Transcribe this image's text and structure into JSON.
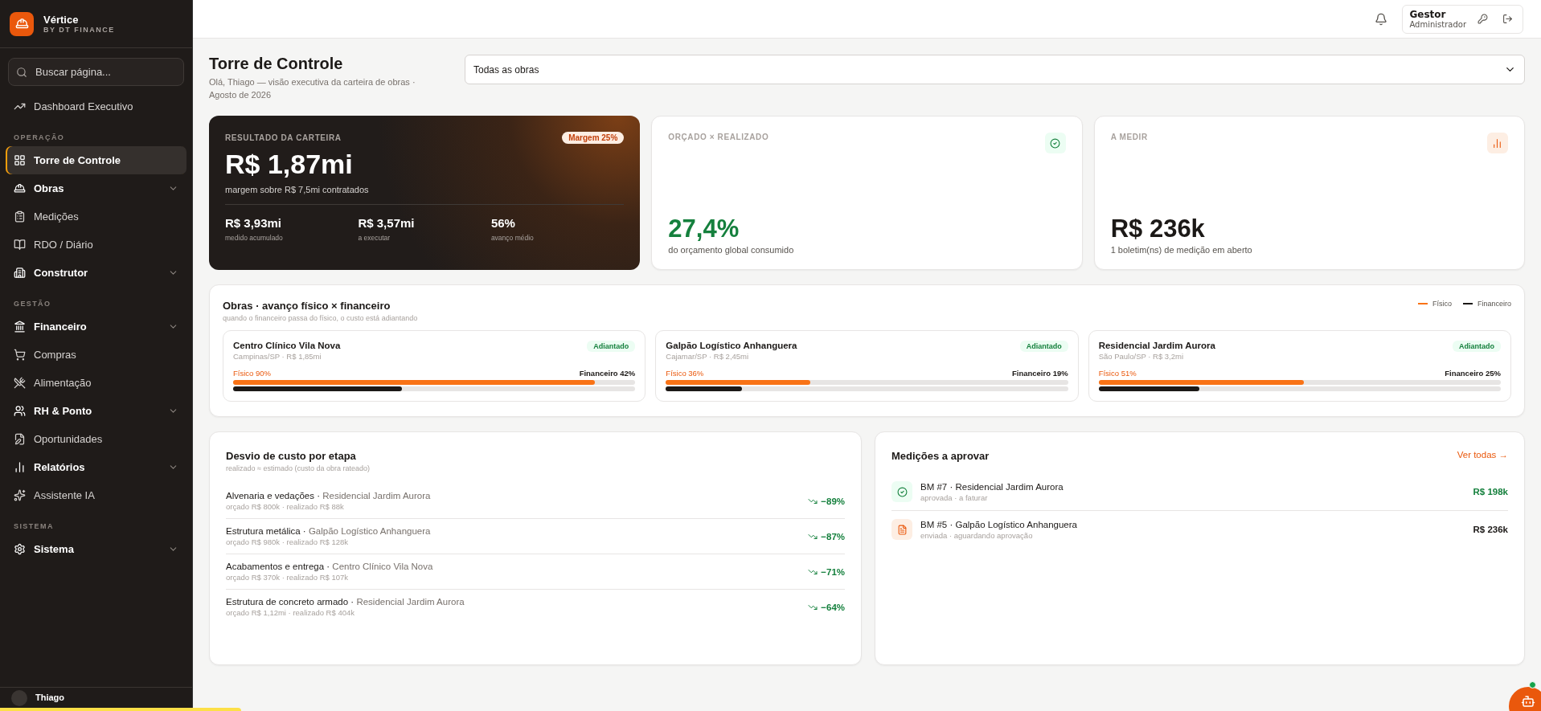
{
  "brand": {
    "name": "Vértice",
    "tagline": "BY DT FINANCE"
  },
  "search": {
    "placeholder": "Buscar página..."
  },
  "sidebar": {
    "top_items": [
      {
        "label": "Dashboard Executivo",
        "kind": "link",
        "selected": false
      }
    ],
    "sections": [
      {
        "heading": "OPERAÇÃO",
        "items": [
          {
            "label": "Torre de Controle",
            "kind": "link",
            "selected": true
          },
          {
            "label": "Obras",
            "kind": "group",
            "selected": false,
            "expanded": false
          },
          {
            "label": "Medições",
            "kind": "link",
            "selected": false
          },
          {
            "label": "RDO / Diário",
            "kind": "link",
            "selected": false
          },
          {
            "label": "Construtor",
            "kind": "group",
            "selected": false,
            "expanded": false
          }
        ]
      },
      {
        "heading": "GESTÃO",
        "items": [
          {
            "label": "Financeiro",
            "kind": "group",
            "selected": false,
            "expanded": false
          },
          {
            "label": "Compras",
            "kind": "link",
            "selected": false
          },
          {
            "label": "Alimentação",
            "kind": "link",
            "selected": false
          },
          {
            "label": "RH & Ponto",
            "kind": "group",
            "selected": false,
            "expanded": false
          },
          {
            "label": "Oportunidades",
            "kind": "link",
            "selected": false
          },
          {
            "label": "Relatórios",
            "kind": "group",
            "selected": false,
            "expanded": false
          },
          {
            "label": "Assistente IA",
            "kind": "link",
            "selected": false
          }
        ]
      },
      {
        "heading": "SISTEMA",
        "items": [
          {
            "label": "Sistema",
            "kind": "group",
            "selected": false,
            "expanded": false
          }
        ]
      }
    ]
  },
  "sidebar_user": {
    "name": "Thiago"
  },
  "header": {
    "user_name": "Gestor",
    "user_role": "Administrador"
  },
  "page": {
    "title": "Torre de Controle",
    "subtitle": "Olá, Thiago — visão executiva da carteira de obras · Agosto de 2026"
  },
  "filter": {
    "value": "Todas as obras"
  },
  "portfolio": {
    "label": "RESULTADO DA CARTEIRA",
    "badge": "Margem 25%",
    "value": "R$ 1,87mi",
    "caption": "margem sobre R$ 7,5mi contratados",
    "stats": [
      {
        "value": "R$ 3,93mi",
        "label": "medido acumulado"
      },
      {
        "value": "R$ 3,57mi",
        "label": "a executar"
      },
      {
        "value": "56%",
        "label": "avanço médio"
      }
    ]
  },
  "kpis": [
    {
      "kind": "check",
      "label": "ORÇADO × REALIZADO",
      "value": "27,4%",
      "caption": "do orçamento global consumido"
    },
    {
      "kind": "chart",
      "label": "A MEDIR",
      "value": "R$ 236k",
      "caption": "1 boletim(ns) de medição em aberto"
    }
  ],
  "progress": {
    "title": "Obras · avanço físico × financeiro",
    "subtitle": "quando o financeiro passa do físico, o custo está adiantando",
    "legend": [
      {
        "label": "Físico",
        "color": "#f97316"
      },
      {
        "label": "Financeiro",
        "color": "#1c1917"
      }
    ],
    "projects": [
      {
        "name": "Centro Clínico Vila Nova",
        "meta": "Campinas/SP · R$ 1,85mi",
        "status": "Adiantado",
        "physical": {
          "label": "Físico 90%",
          "level": 0.9
        },
        "financial": {
          "label": "Financeiro 42%",
          "level": 0.42
        }
      },
      {
        "name": "Galpão Logístico Anhanguera",
        "meta": "Cajamar/SP · R$ 2,45mi",
        "status": "Adiantado",
        "physical": {
          "label": "Físico 36%",
          "level": 0.36
        },
        "financial": {
          "label": "Financeiro 19%",
          "level": 0.19
        }
      },
      {
        "name": "Residencial Jardim Aurora",
        "meta": "São Paulo/SP · R$ 3,2mi",
        "status": "Adiantado",
        "physical": {
          "label": "Físico 51%",
          "level": 0.51
        },
        "financial": {
          "label": "Financeiro 25%",
          "level": 0.25
        }
      }
    ]
  },
  "deviation": {
    "title": "Desvio de custo por etapa",
    "subtitle": "realizado ≈ estimado (custo da obra rateado)",
    "rows": [
      {
        "stage": "Alvenaria e vedações ·",
        "project": "Residencial Jardim Aurora",
        "detail": "orçado R$ 800k · realizado R$ 88k",
        "value": "−89%"
      },
      {
        "stage": "Estrutura metálica ·",
        "project": "Galpão Logístico Anhanguera",
        "detail": "orçado R$ 980k · realizado R$ 128k",
        "value": "−87%"
      },
      {
        "stage": "Acabamentos e entrega ·",
        "project": "Centro Clínico Vila Nova",
        "detail": "orçado R$ 370k · realizado R$ 107k",
        "value": "−71%"
      },
      {
        "stage": "Estrutura de concreto armado ·",
        "project": "Residencial Jardim Aurora",
        "detail": "orçado R$ 1,12mi · realizado R$ 404k",
        "value": "−64%"
      }
    ]
  },
  "approvals": {
    "title": "Medições a aprovar",
    "link": "Ver todas →",
    "items": [
      {
        "kind": "approved",
        "title": "BM #7 · Residencial Jardim Aurora",
        "detail": "aprovada · a faturar",
        "value": "R$ 198k"
      },
      {
        "kind": "sent",
        "title": "BM #5 · Galpão Logístico Anhanguera",
        "detail": "enviada · aguardando aprovação",
        "value": "R$ 236k"
      }
    ]
  }
}
